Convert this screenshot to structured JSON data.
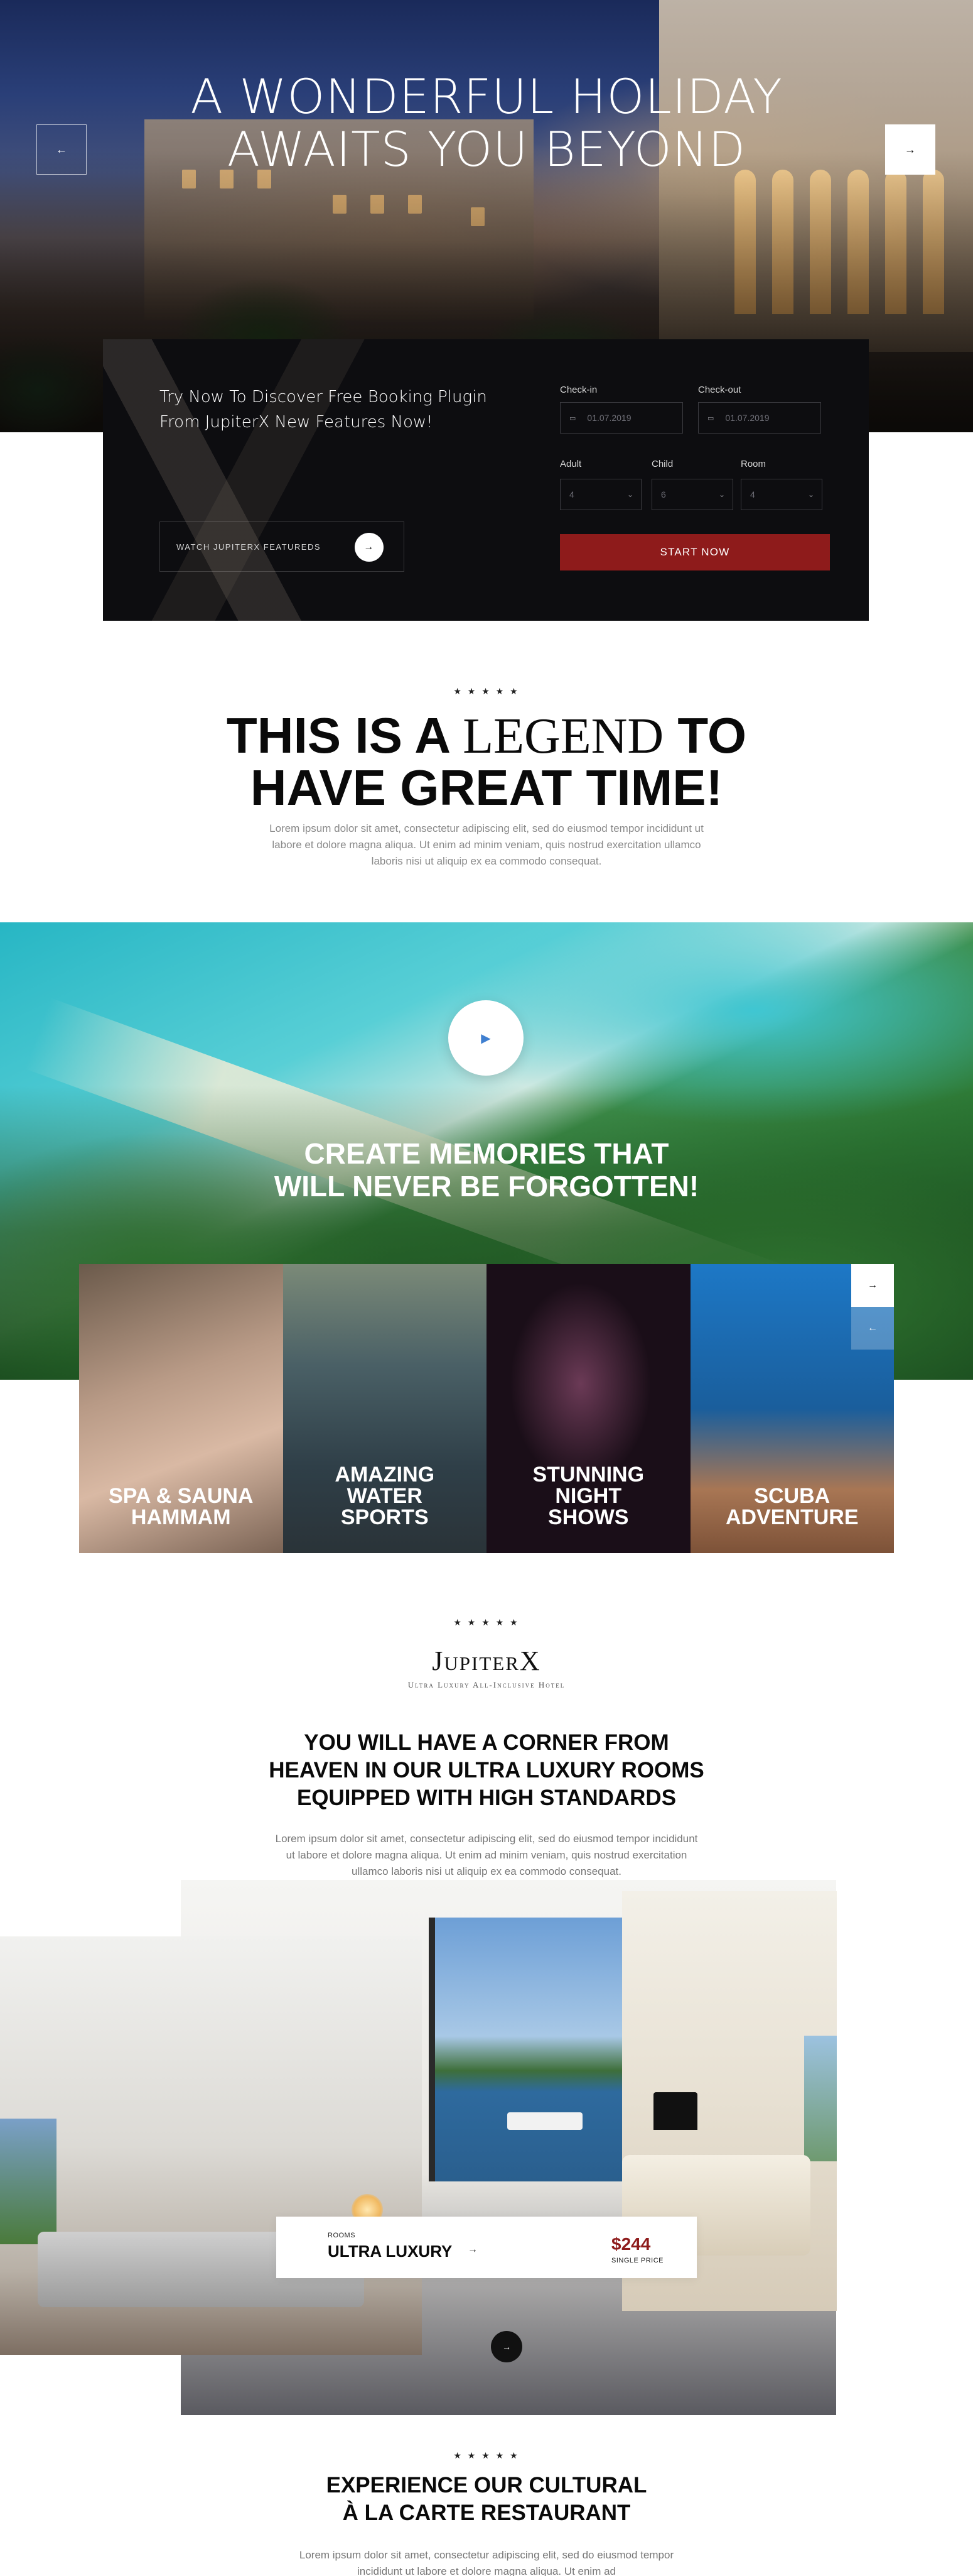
{
  "hero": {
    "title_line1": "A WONDERFUL HOLIDAY",
    "title_line2": "AWAITS YOU BEYOND",
    "prev_icon": "←",
    "next_icon": "→"
  },
  "booking": {
    "promo_line1": "Try Now To Discover Free Booking Plugin",
    "promo_line2": "From JupiterX New Features Now!",
    "watch_label": "WATCH JUPITERX FEATUREDS",
    "watch_icon": "→",
    "checkin_label": "Check-in",
    "checkin_value": "01.07.2019",
    "checkout_label": "Check-out",
    "checkout_value": "01.07.2019",
    "adult_label": "Adult",
    "adult_value": "4",
    "child_label": "Child",
    "child_value": "6",
    "room_label": "Room",
    "room_value": "4",
    "start_label": "START NOW",
    "calendar_icon": "▭",
    "chevron_icon": "⌄"
  },
  "legend": {
    "stars": "★ ★ ★ ★ ★",
    "title_a": "THIS IS A",
    "title_b": "LEGEND",
    "title_c": "TO",
    "title_line2": "HAVE GREAT TIME!",
    "lorem_line1": "Lorem ipsum dolor sit amet, consectetur adipiscing elit, sed do eiusmod tempor incididunt ut",
    "lorem_line2": "labore et dolore magna aliqua. Ut enim ad minim veniam, quis nostrud exercitation ullamco",
    "lorem_line3": "laboris nisi ut aliquip ex ea commodo consequat."
  },
  "memories": {
    "play_icon": "▶",
    "line1": "CREATE MEMORIES THAT",
    "line2": "WILL NEVER BE FORGOTTEN!"
  },
  "activities": {
    "next_icon": "→",
    "prev_icon": "←",
    "cards": [
      {
        "line1": "SPA & SAUNA",
        "line2": "HAMMAM",
        "line3": ""
      },
      {
        "line1": "AMAZING",
        "line2": "WATER",
        "line3": "SPORTS"
      },
      {
        "line1": "STUNNING",
        "line2": "NIGHT",
        "line3": "SHOWS"
      },
      {
        "line1": "SCUBA",
        "line2": "ADVENTURE",
        "line3": ""
      }
    ]
  },
  "brand": {
    "stars": "★ ★ ★ ★ ★",
    "name": "JupiterX",
    "tagline": "Ultra Luxury All-Inclusive Hotel"
  },
  "rooms": {
    "title_line1": "YOU WILL HAVE A CORNER FROM",
    "title_line2": "HEAVEN IN OUR ULTRA LUXURY ROOMS",
    "title_line3": "EQUIPPED WITH HIGH STANDARDS",
    "lorem_line1": "Lorem ipsum dolor sit amet, consectetur adipiscing elit, sed do eiusmod tempor incididunt",
    "lorem_line2": "ut labore et dolore magna aliqua. Ut enim ad minim veniam, quis nostrud exercitation",
    "lorem_line3": "ullamco laboris nisi ut aliquip ex ea commodo consequat.",
    "card_kicker": "ROOMS",
    "card_name": "ULTRA LUXURY",
    "card_arrow": "→",
    "card_price": "$244",
    "card_price_note": "SINGLE PRICE",
    "next_icon": "→"
  },
  "restaurant": {
    "stars": "★ ★ ★ ★ ★",
    "title_line1": "EXPERIENCE OUR CULTURAL",
    "title_line2": "À LA CARTE RESTAURANT",
    "lorem_line1": "Lorem ipsum dolor sit amet, consectetur adipiscing elit, sed do eiusmod tempor",
    "lorem_line2": "incididunt ut labore et dolore magna aliqua. Ut enim ad"
  }
}
